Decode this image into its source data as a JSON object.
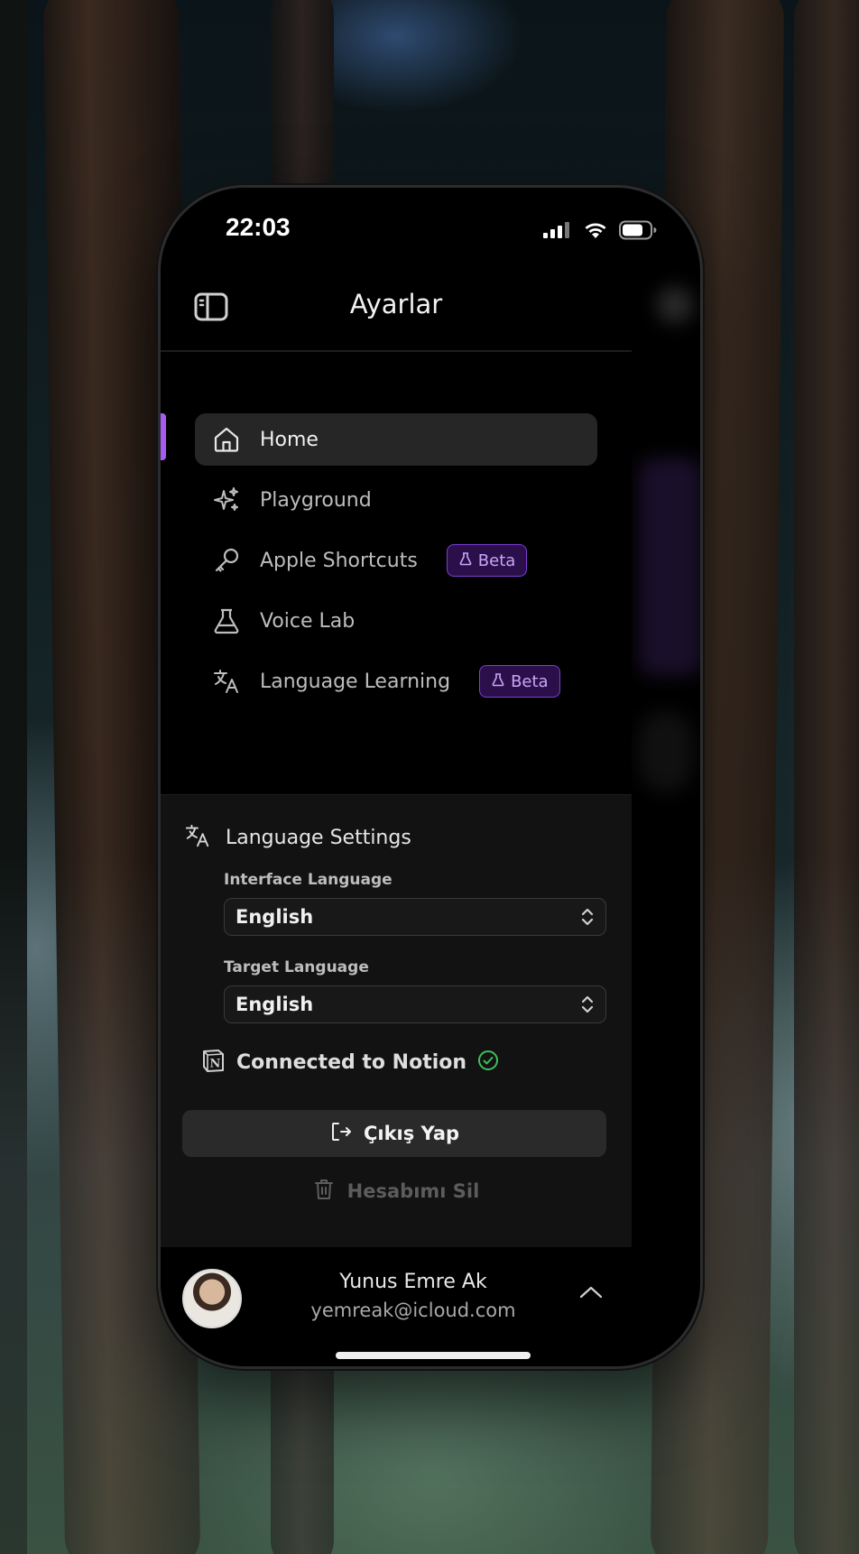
{
  "status": {
    "time": "22:03"
  },
  "header": {
    "title": "Ayarlar"
  },
  "nav": {
    "items": [
      {
        "label": "Home",
        "icon": "home-icon",
        "active": true
      },
      {
        "label": "Playground",
        "icon": "sparkles-icon"
      },
      {
        "label": "Apple Shortcuts",
        "icon": "key-icon",
        "badge": "Beta"
      },
      {
        "label": "Voice Lab",
        "icon": "flask-icon"
      },
      {
        "label": "Language Learning",
        "icon": "translate-icon",
        "badge": "Beta"
      }
    ]
  },
  "settings": {
    "heading": "Language Settings",
    "interface_language_label": "Interface Language",
    "interface_language_value": "English",
    "target_language_label": "Target Language",
    "target_language_value": "English",
    "notion_status": "Connected to Notion",
    "logout_label": "Çıkış Yap",
    "delete_label": "Hesabımı Sil"
  },
  "user": {
    "name": "Yunus Emre Ak",
    "email": "yemreak@icloud.com"
  },
  "colors": {
    "accent": "#a65cf0",
    "beta_bg": "#2a0f4a",
    "beta_text": "#c8a6f5",
    "success": "#3fbf5a"
  }
}
